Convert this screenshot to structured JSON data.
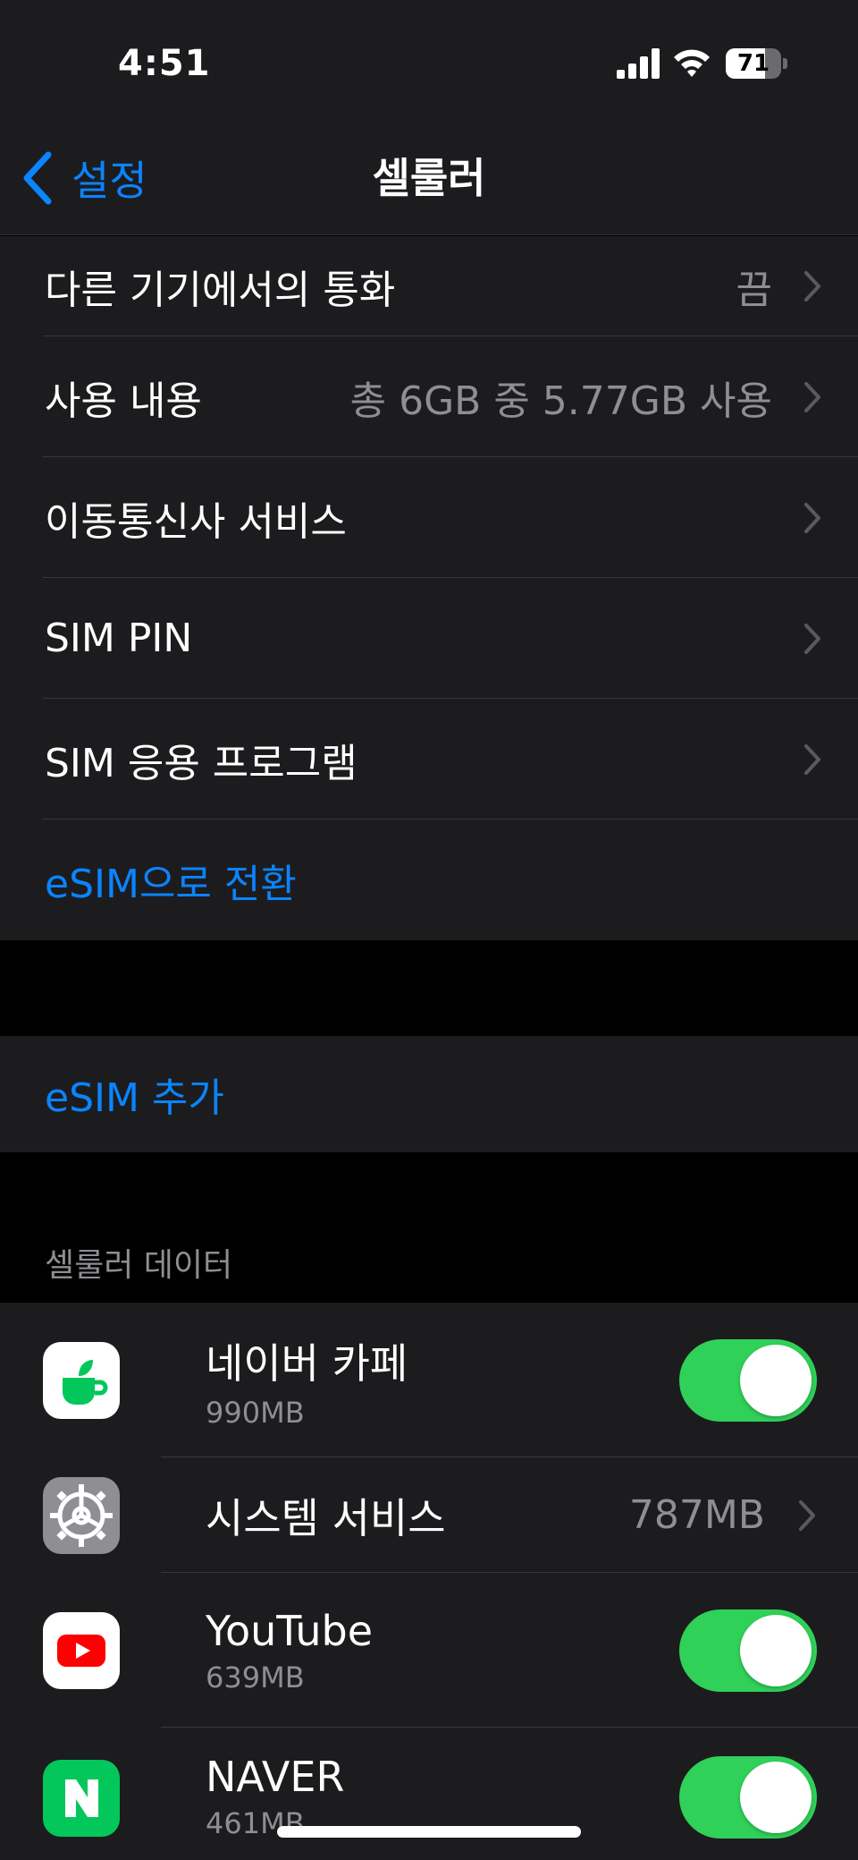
{
  "status_bar": {
    "time": "4:51",
    "battery_level": "71",
    "battery_fraction": 0.71
  },
  "nav": {
    "back_label": "설정",
    "title": "셀룰러"
  },
  "settings_group": [
    {
      "label": "다른 기기에서의 통화",
      "value": "끔"
    },
    {
      "label": "사용 내용",
      "value": "총 6GB 중 5.77GB 사용"
    },
    {
      "label": "이동통신사 서비스",
      "value": ""
    },
    {
      "label": "SIM PIN",
      "value": ""
    },
    {
      "label": "SIM 응용 프로그램",
      "value": ""
    },
    {
      "label": "eSIM으로 전환"
    }
  ],
  "add_esim": {
    "label": "eSIM 추가"
  },
  "cellular_data": {
    "header": "셀룰러 데이터",
    "apps": [
      {
        "name": "네이버 카페",
        "size": "990MB",
        "enabled": true,
        "icon": "naver-cafe-icon"
      },
      {
        "name": "시스템 서비스",
        "value": "787MB",
        "icon": "gear-icon"
      },
      {
        "name": "YouTube",
        "size": "639MB",
        "enabled": true,
        "icon": "youtube-icon"
      },
      {
        "name": "NAVER",
        "size": "461MB",
        "enabled": true,
        "icon": "naver-icon"
      }
    ]
  },
  "colors": {
    "accent": "#0a84ff",
    "toggle_on": "#30d158",
    "background": "#000000",
    "cell": "#1c1c1e"
  }
}
